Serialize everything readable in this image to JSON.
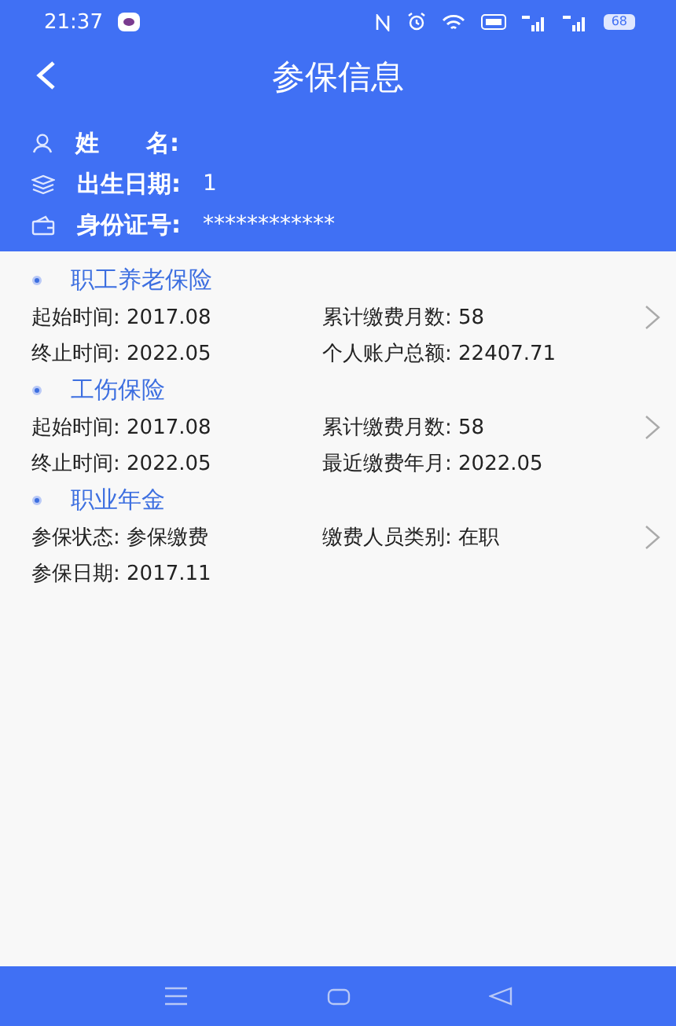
{
  "status_bar": {
    "time": "21:37",
    "battery": "68"
  },
  "header": {
    "title": "参保信息"
  },
  "person": [
    {
      "kind": "user",
      "label": "姓　　名:"
    },
    {
      "kind": "layers",
      "label": "出生日期:",
      "value": "1"
    },
    {
      "kind": "card",
      "label": "身份证号:",
      "value": "************"
    }
  ],
  "sections": [
    {
      "title": "职工养老保险",
      "rows": [
        [
          {
            "label": "起始时间:",
            "value": "2017.08"
          },
          {
            "label": "累计缴费月数:",
            "value": "58"
          }
        ],
        [
          {
            "label": "终止时间:",
            "value": "2022.05"
          },
          {
            "label": "个人账户总额:",
            "value": "22407.71"
          }
        ]
      ]
    },
    {
      "title": "工伤保险",
      "rows": [
        [
          {
            "label": "起始时间:",
            "value": "2017.08"
          },
          {
            "label": "累计缴费月数:",
            "value": "58"
          }
        ],
        [
          {
            "label": "终止时间:",
            "value": "2022.05"
          },
          {
            "label": "最近缴费年月:",
            "value": "2022.05"
          }
        ]
      ]
    },
    {
      "title": "职业年金",
      "rows": [
        [
          {
            "label": "参保状态:",
            "value": "参保缴费"
          },
          {
            "label": "缴费人员类别:",
            "value": "在职"
          }
        ],
        [
          {
            "label": "参保日期:",
            "value": "2017.11"
          }
        ]
      ]
    }
  ]
}
